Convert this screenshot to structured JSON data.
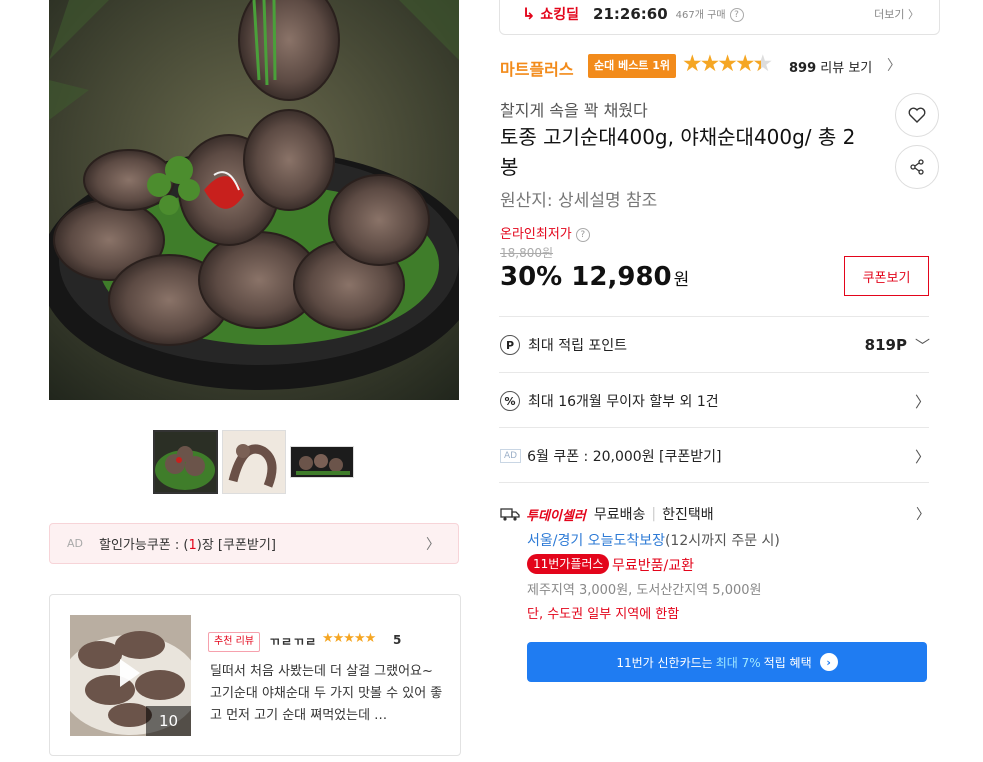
{
  "deal": {
    "logo": "쇼킹딜",
    "time": "21:26:60",
    "count": "467개 구매",
    "more": "더보기 〉"
  },
  "seller": {
    "name": "마트플러스",
    "badge": "순대 베스트 1위",
    "rating": 4.5,
    "review_count": "899",
    "review_label": "리뷰 보기"
  },
  "product": {
    "subtitle": "찰지게 속을 꽉 채웠다",
    "title": "토종 고기순대400g, 야채순대400g/ 총 2봉",
    "origin": "원산지: 상세설명 참조"
  },
  "price": {
    "lowest_label": "온라인최저가",
    "original": "18,800원",
    "discount": "30%",
    "sale": "12,980",
    "won": "원",
    "coupon_button": "쿠폰보기"
  },
  "benefits": [
    {
      "icon": "P",
      "label": "최대 적립 포인트",
      "value": "819P"
    },
    {
      "icon": "%",
      "label": "최대 16개월 무이자 할부 외 1건"
    },
    {
      "ad": "AD",
      "label": "6월 쿠폰 : 20,000원 [쿠폰받기]"
    }
  ],
  "shipping": {
    "badge": "투데이셀러",
    "free": "무료배송",
    "carrier": "한진택배",
    "region": "서울/경기 오늘도착보장",
    "cutoff": "(12시까지 주문 시)",
    "plus_badge": "11번가플러스",
    "plus_text": "무료반품/교환",
    "extra_fee": "제주지역 3,000원, 도서산간지역 5,000원",
    "limit": "단, 수도권 일부 지역에 한함"
  },
  "card_promo": {
    "prefix": "11번가 신한카드는",
    "highlight": "최대 7%",
    "suffix": "적립 혜택"
  },
  "left": {
    "ad_tag": "AD",
    "coupon_prefix": "할인가능쿠폰 : (",
    "coupon_num": "1",
    "coupon_suffix": ")장 [쿠폰받기]",
    "review": {
      "badge": "추천 리뷰",
      "user": "ㄲㄹㄲㄹ",
      "stars": "★★★★★",
      "score": "5",
      "text": "딜떠서 처음 사봤는데 더 살걸 그랬어요~ 고기순대 야채순대 두 가지 맛볼 수 있어 좋고 먼저 고기 순대 쪄먹었는데 …",
      "media_count": "10"
    }
  },
  "colors": {
    "accent_red": "#e3051b",
    "brand_orange": "#f28b1b",
    "star": "#f5a623",
    "card_blue": "#1f7cf2"
  }
}
